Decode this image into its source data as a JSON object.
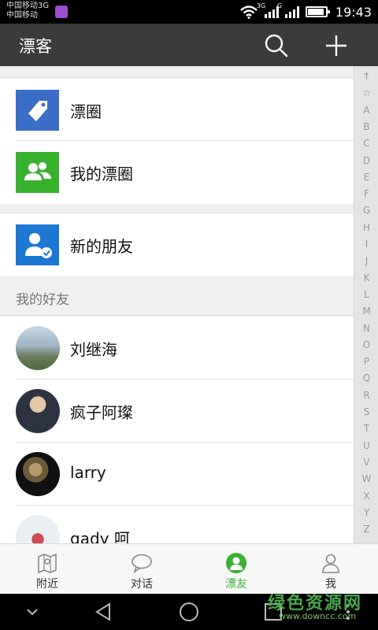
{
  "status_bar": {
    "carrier_1": "中国移动3G",
    "carrier_2": "中国移动",
    "sim1_net": "3G",
    "sim2_net": "G",
    "time": "19:43"
  },
  "app_bar": {
    "title": "漂客",
    "search_icon": "search-icon",
    "add_icon": "plus-icon"
  },
  "top_items": [
    {
      "label": "漂圈",
      "icon": "tag-icon",
      "color": "#3b6ec6"
    },
    {
      "label": "我的漂圈",
      "icon": "group-icon",
      "color": "#38b22e"
    },
    {
      "label": "新的朋友",
      "icon": "add-friend-icon",
      "color": "#1f77d4"
    }
  ],
  "friends_section": {
    "header": "我的好友",
    "friends": [
      {
        "name": "刘继海"
      },
      {
        "name": "疯子阿璨"
      },
      {
        "name": "larry"
      },
      {
        "name": "gady 呵"
      }
    ]
  },
  "index_bar": [
    "↑",
    "☆",
    "A",
    "B",
    "C",
    "D",
    "E",
    "F",
    "G",
    "H",
    "I",
    "J",
    "K",
    "L",
    "M",
    "N",
    "O",
    "P",
    "Q",
    "R",
    "S",
    "T",
    "U",
    "V",
    "W",
    "X",
    "Y",
    "Z"
  ],
  "bottom_nav": [
    {
      "label": "附近",
      "icon": "map-icon"
    },
    {
      "label": "对话",
      "icon": "chat-bubble-icon"
    },
    {
      "label": "漂友",
      "icon": "friend-icon",
      "active": true
    },
    {
      "label": "我",
      "icon": "person-icon"
    }
  ],
  "watermark": {
    "title": "绿色资源网",
    "url": "www.downcc.com"
  },
  "colors": {
    "accent": "#3cb034",
    "app_bar": "#3b3b3b"
  }
}
